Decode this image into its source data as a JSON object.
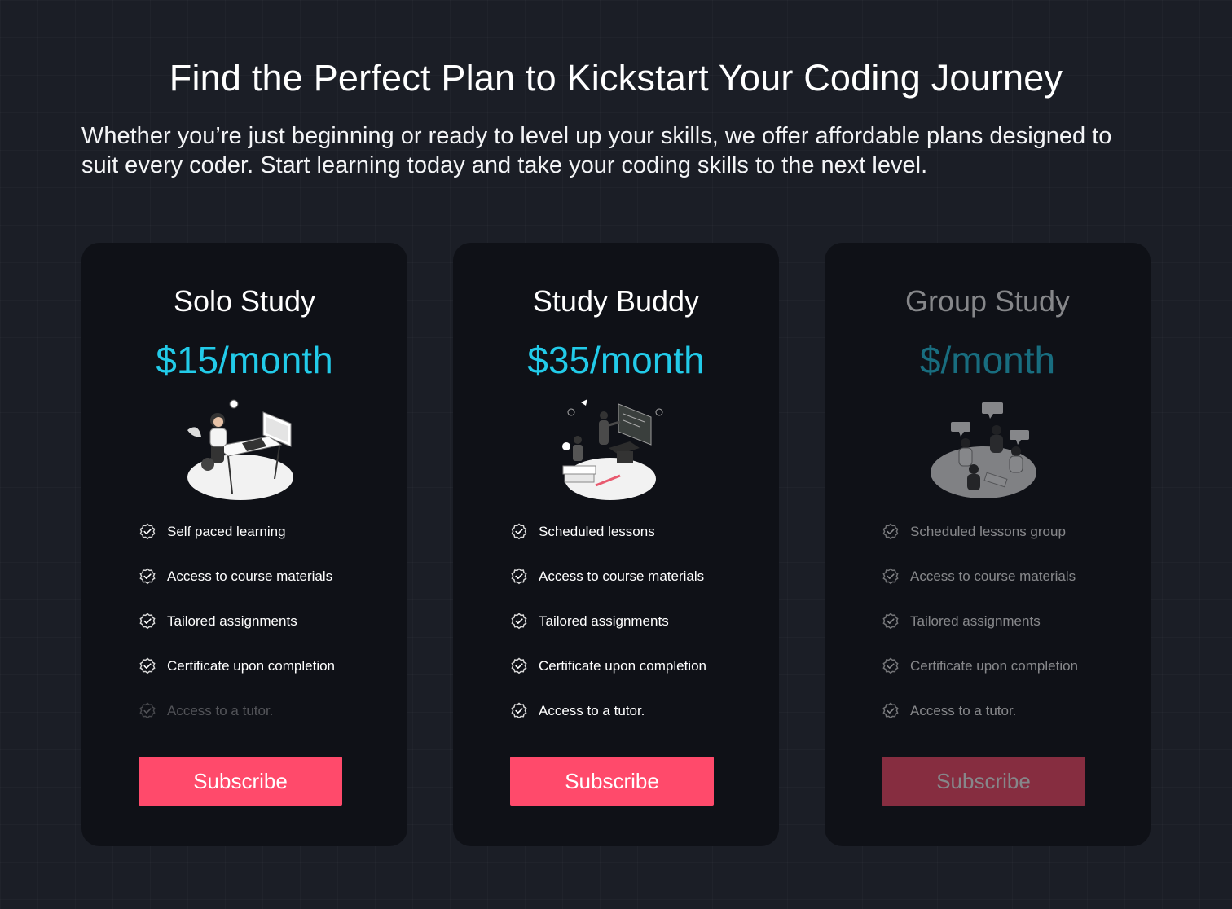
{
  "header": {
    "title": "Find the Perfect Plan to Kickstart Your Coding Journey",
    "subtitle": "Whether you’re just beginning or ready to level up your skills, we offer affordable plans designed to suit every coder. Start learning today and take your coding skills to the next level."
  },
  "colors": {
    "background": "#1b1e26",
    "card": "#0f1117",
    "price": "#22cbe9",
    "button": "#ff4a6b"
  },
  "plans": [
    {
      "name": "Solo Study",
      "price": "$15/month",
      "illustration": "person-studying-at-desk",
      "features": [
        {
          "label": "Self paced learning",
          "icon": "check-badge-icon",
          "included": true
        },
        {
          "label": "Access to course materials",
          "icon": "check-badge-icon",
          "included": true
        },
        {
          "label": "Tailored assignments",
          "icon": "check-badge-icon",
          "included": true
        },
        {
          "label": "Certificate upon completion",
          "icon": "check-badge-icon",
          "included": true
        },
        {
          "label": "Access to a tutor.",
          "icon": "check-badge-icon",
          "included": false
        }
      ],
      "button": "Subscribe"
    },
    {
      "name": "Study Buddy",
      "price": "$35/month",
      "illustration": "tutor-with-student-at-board",
      "features": [
        {
          "label": "Scheduled lessons",
          "icon": "check-badge-icon",
          "included": true
        },
        {
          "label": "Access to course materials",
          "icon": "check-badge-icon",
          "included": true
        },
        {
          "label": "Tailored assignments",
          "icon": "check-badge-icon",
          "included": true
        },
        {
          "label": "Certificate upon completion",
          "icon": "check-badge-icon",
          "included": true
        },
        {
          "label": "Access to a tutor.",
          "icon": "check-badge-icon",
          "included": true
        }
      ],
      "button": "Subscribe"
    },
    {
      "name": "Group Study",
      "price": "$/month",
      "illustration": "group-discussion",
      "disabled": true,
      "features": [
        {
          "label": "Scheduled lessons group",
          "icon": "check-badge-icon",
          "included": true
        },
        {
          "label": "Access to course materials",
          "icon": "check-badge-icon",
          "included": true
        },
        {
          "label": "Tailored assignments",
          "icon": "check-badge-icon",
          "included": true
        },
        {
          "label": "Certificate upon completion",
          "icon": "check-badge-icon",
          "included": true
        },
        {
          "label": "Access to a tutor.",
          "icon": "check-badge-icon",
          "included": true
        }
      ],
      "button": "Subscribe"
    }
  ]
}
